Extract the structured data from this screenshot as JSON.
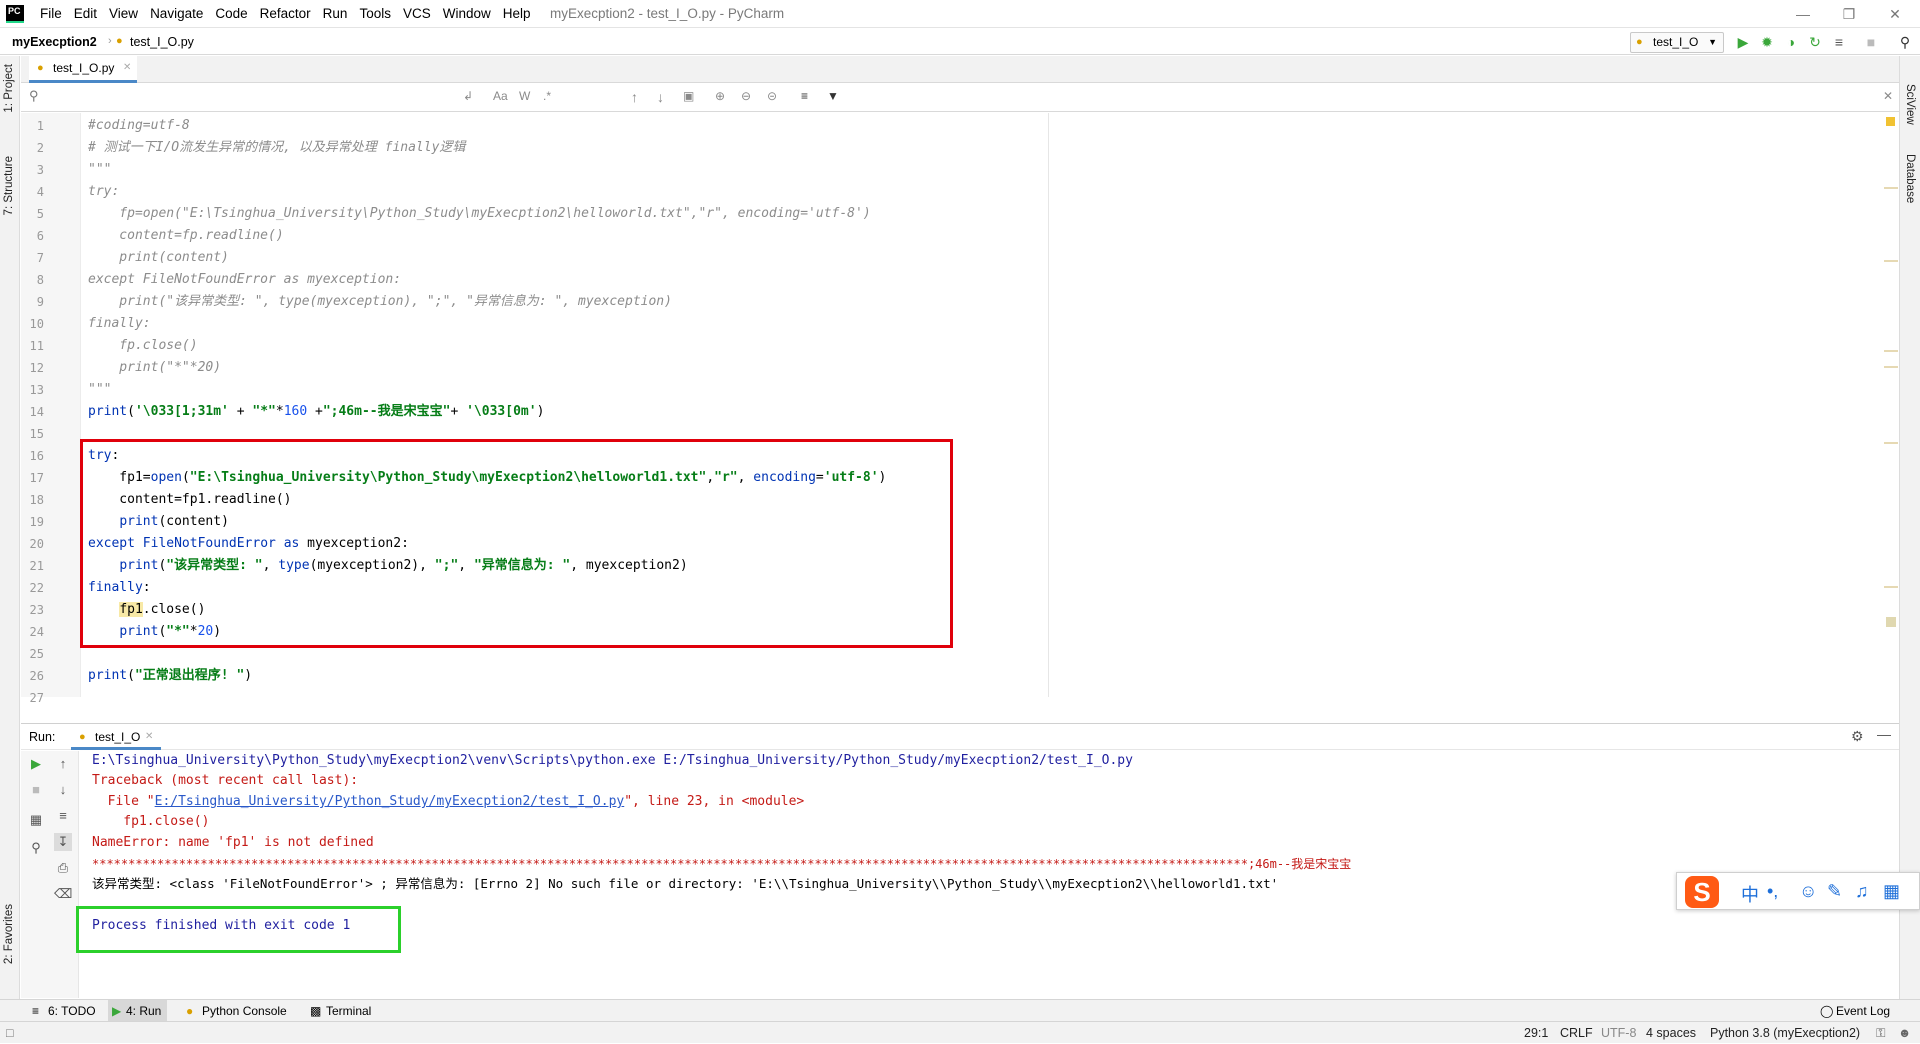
{
  "app": {
    "logo_text": "PC",
    "window_title": "myExecption2 - test_I_O.py - PyCharm"
  },
  "menu": [
    "File",
    "Edit",
    "View",
    "Navigate",
    "Code",
    "Refactor",
    "Run",
    "Tools",
    "VCS",
    "Window",
    "Help"
  ],
  "breadcrumb": {
    "project": "myExecption2",
    "file": "test_I_O.py"
  },
  "run_config": "test_I_O",
  "tool_windows": {
    "left": [
      "1: Project",
      "7: Structure",
      "2: Favorites"
    ],
    "right": [
      "SciView",
      "Database"
    ]
  },
  "editor": {
    "tab": "test_I_O.py",
    "search_placeholder": "",
    "find_options": [
      "Aa",
      "W",
      ".*"
    ],
    "line_numbers": [
      "1",
      "2",
      "3",
      "4",
      "5",
      "6",
      "7",
      "8",
      "9",
      "10",
      "11",
      "12",
      "13",
      "14",
      "15",
      "16",
      "17",
      "18",
      "19",
      "20",
      "21",
      "22",
      "23",
      "24",
      "25",
      "26",
      "27"
    ]
  },
  "run_panel": {
    "label": "Run:",
    "tab": "test_I_O",
    "output": [
      "E:\\Tsinghua_University\\Python_Study\\myExecption2\\venv\\Scripts\\python.exe E:/Tsinghua_University/Python_Study/myExecption2/test_I_O.py",
      "Traceback (most recent call last):",
      "  File \"",
      "E:/Tsinghua_University/Python_Study/myExecption2/test_I_O.py",
      "\", line 23, in <module>",
      "    fp1.close()",
      "NameError: name 'fp1' is not defined",
      "****************************************************************************************************************************************************************;46m--我是宋宝宝",
      "该异常类型: <class 'FileNotFoundError'> ; 异常信息为: [Errno 2] No such file or directory: 'E:\\\\Tsinghua_University\\\\Python_Study\\\\myExecption2\\\\helloworld1.txt'",
      "Process finished with exit code 1"
    ]
  },
  "ime": {
    "logo": "S",
    "mode": "中",
    "punct": "•,"
  },
  "bottom_tabs": [
    "6: TODO",
    "4: Run",
    "Python Console",
    "Terminal"
  ],
  "event_log": "Event Log",
  "status": {
    "position": "29:1",
    "line_ending": "CRLF",
    "encoding": "UTF-8",
    "indent": "4 spaces",
    "interpreter": "Python 3.8 (myExecption2)"
  }
}
